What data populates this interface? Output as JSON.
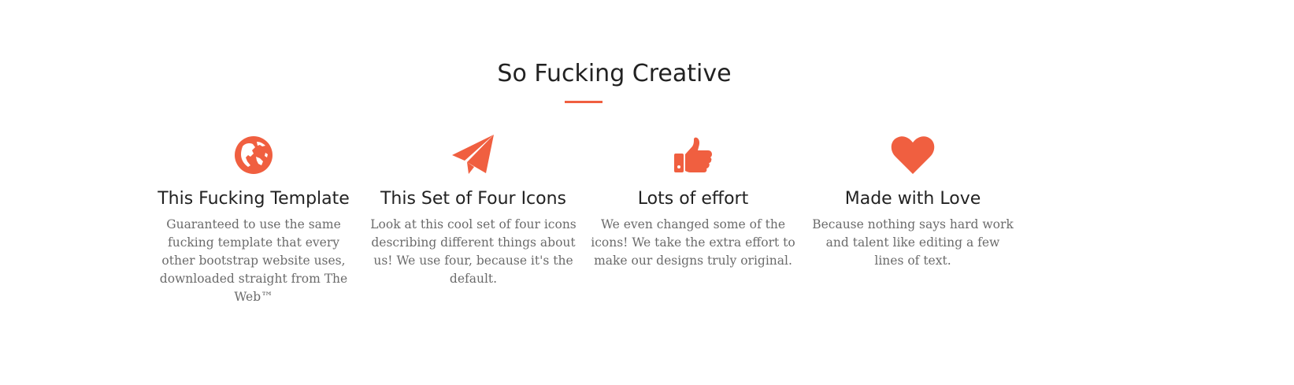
{
  "section": {
    "title": "So Fucking Creative",
    "accent_color": "#F05F40"
  },
  "features": [
    {
      "icon": "globe-icon",
      "title": "This Fucking Template",
      "text": "Guaranteed to use the same fucking template that every other bootstrap website uses, downloaded straight from The Web™"
    },
    {
      "icon": "paper-plane-icon",
      "title": "This Set of Four Icons",
      "text": "Look at this cool set of four icons describing different things about us! We use four, because it's the default."
    },
    {
      "icon": "thumbs-up-icon",
      "title": "Lots of effort",
      "text": "We even changed some of the icons! We take the extra effort to make our designs truly original."
    },
    {
      "icon": "heart-icon",
      "title": "Made with Love",
      "text": "Because nothing says hard work and talent like editing a few lines of text."
    }
  ]
}
